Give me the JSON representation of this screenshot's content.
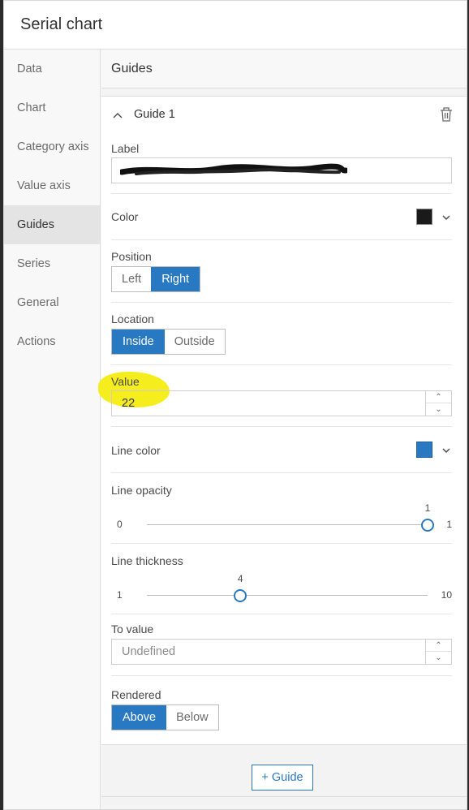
{
  "window": {
    "title": "Serial chart"
  },
  "sidebar": {
    "items": [
      {
        "label": "Data"
      },
      {
        "label": "Chart"
      },
      {
        "label": "Category axis"
      },
      {
        "label": "Value axis"
      },
      {
        "label": "Guides"
      },
      {
        "label": "Series"
      },
      {
        "label": "General"
      },
      {
        "label": "Actions"
      }
    ],
    "active": "Guides"
  },
  "main": {
    "section_title": "Guides",
    "guide": {
      "title": "Guide 1",
      "label": {
        "caption": "Label",
        "value": ""
      },
      "color": {
        "caption": "Color",
        "value": "#1a1a1a"
      },
      "position": {
        "caption": "Position",
        "options": [
          "Left",
          "Right"
        ],
        "selected": "Right"
      },
      "location": {
        "caption": "Location",
        "options": [
          "Inside",
          "Outside"
        ],
        "selected": "Inside"
      },
      "value": {
        "caption": "Value",
        "value": "22"
      },
      "line_color": {
        "caption": "Line color",
        "value": "#2979c2"
      },
      "line_opacity": {
        "caption": "Line opacity",
        "min": "0",
        "max": "1",
        "current": "1",
        "fraction": 1.0
      },
      "line_thickness": {
        "caption": "Line thickness",
        "min": "1",
        "max": "10",
        "current": "4",
        "fraction": 0.333
      },
      "to_value": {
        "caption": "To value",
        "placeholder": "Undefined"
      },
      "rendered": {
        "caption": "Rendered",
        "options": [
          "Above",
          "Below"
        ],
        "selected": "Above"
      }
    },
    "add_button": "+ Guide"
  },
  "icons": {
    "collapse": "chevron-up-icon",
    "delete": "trash-icon",
    "dropdown": "chevron-down-icon",
    "spin_up": "caret-up-icon",
    "spin_down": "caret-down-icon"
  },
  "colors": {
    "accent": "#2979c2",
    "highlight": "#f6ec12"
  }
}
